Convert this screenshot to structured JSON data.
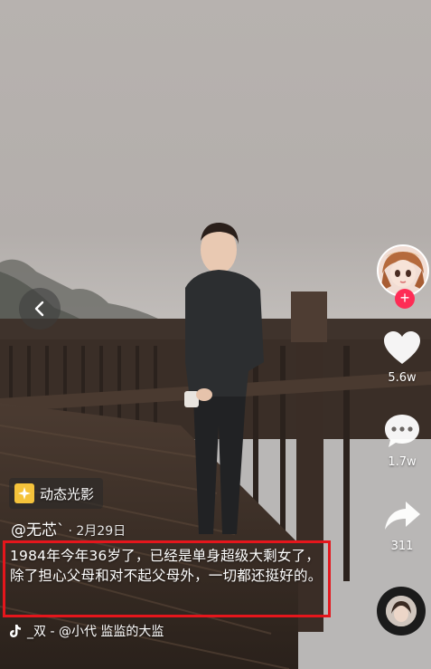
{
  "video": {
    "badge_label": "动态光影",
    "author": "@无芯`",
    "date": "· 2月29日",
    "caption": "1984年今年36岁了，已经是单身超级大剩女了，除了担心父母和对不起父母外，一切都还挺好的。",
    "music": "_双 - @小代   监监的大监"
  },
  "actions": {
    "like_count": "5.6w",
    "comment_count": "1.7w",
    "share_count": "311"
  },
  "icons": {
    "back": "chevron-left-icon",
    "like": "heart-icon",
    "comment": "comment-bubble-icon",
    "share": "share-arrow-icon",
    "music": "tiktok-note-icon",
    "follow": "plus-icon"
  },
  "colors": {
    "follow_red": "#fe2c55",
    "highlight_red": "#e5161c",
    "badge_yellow": "#f5c33b"
  }
}
